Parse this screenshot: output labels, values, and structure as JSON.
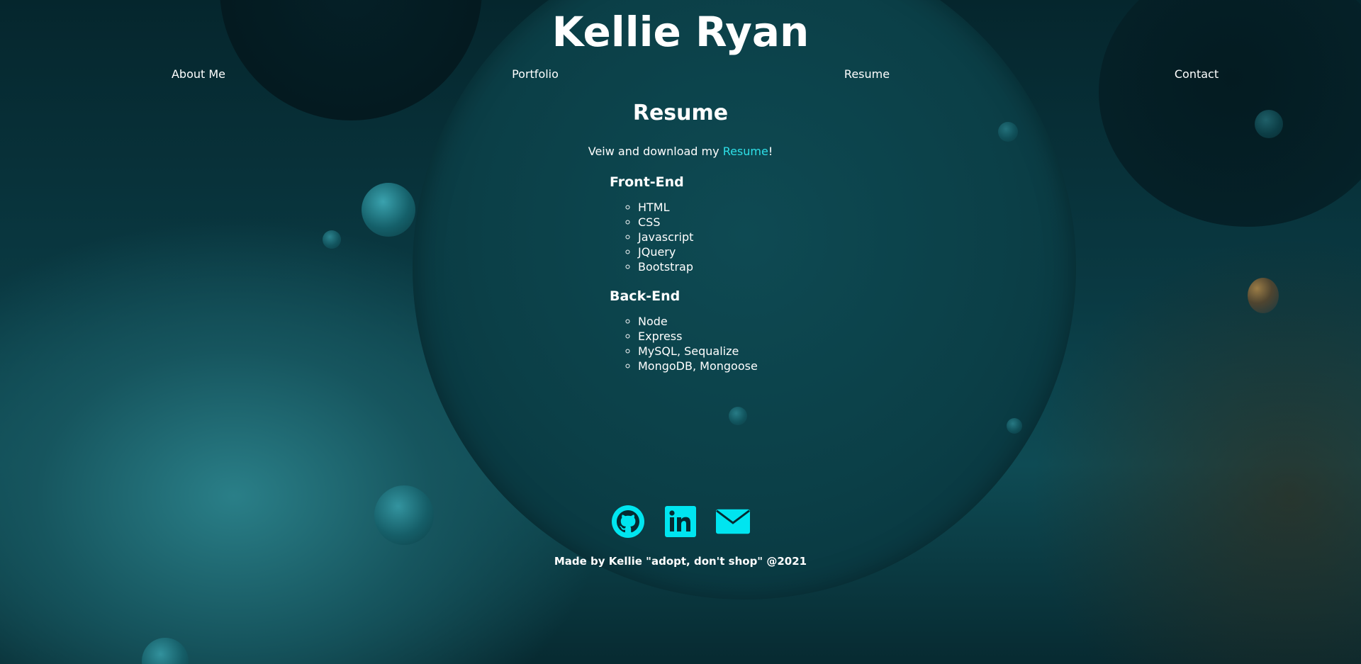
{
  "site": {
    "title": "Kellie Ryan"
  },
  "nav": {
    "items": [
      {
        "label": "About Me"
      },
      {
        "label": "Portfolio"
      },
      {
        "label": "Resume"
      },
      {
        "label": "Contact"
      }
    ]
  },
  "main": {
    "section_title": "Resume",
    "intro_prefix": "Veiw and download my ",
    "intro_link": "Resume",
    "intro_suffix": "!",
    "frontend": {
      "heading": "Front-End",
      "items": [
        "HTML",
        "CSS",
        "Javascript",
        "JQuery",
        "Bootstrap"
      ]
    },
    "backend": {
      "heading": "Back-End",
      "items": [
        "Node",
        "Express",
        "MySQL, Sequalize",
        "MongoDB, Mongoose"
      ]
    }
  },
  "footer": {
    "icons": [
      "github-icon",
      "linkedin-icon",
      "email-icon"
    ],
    "text": "Made by Kellie \"adopt, don't shop\" @2021",
    "icon_color": "#00e5f0"
  },
  "colors": {
    "link": "#2ee0e8",
    "text": "#ffffff"
  }
}
